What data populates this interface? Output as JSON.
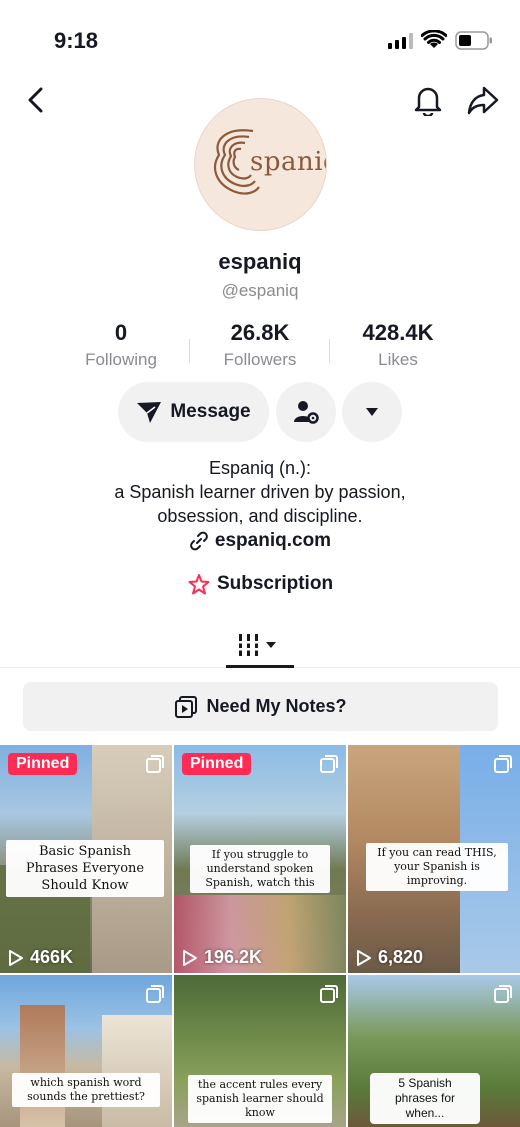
{
  "status_bar": {
    "time": "9:18"
  },
  "profile": {
    "avatar_text": "spaniq",
    "username": "espaniq",
    "handle": "@espaniq"
  },
  "stats": [
    {
      "value": "0",
      "label": "Following"
    },
    {
      "value": "26.8K",
      "label": "Followers"
    },
    {
      "value": "428.4K",
      "label": "Likes"
    }
  ],
  "actions": {
    "message_label": "Message"
  },
  "bio": {
    "line1": "Espaniq (n.):",
    "line2": "a Spanish learner driven by passion,",
    "line3": "obsession, and discipline.",
    "link": "espaniq.com",
    "subscription": "Subscription"
  },
  "notes_button": "Need My Notes?",
  "videos": [
    {
      "pinned": "Pinned",
      "caption": "Basic Spanish Phrases Everyone Should Know",
      "views": "466K"
    },
    {
      "pinned": "Pinned",
      "caption": "If you struggle to understand spoken Spanish, watch this",
      "views": "196.2K"
    },
    {
      "pinned": "",
      "caption": "If you can read THIS, your Spanish is improving.",
      "views": "6,820"
    },
    {
      "pinned": "",
      "caption": "which spanish word sounds the prettiest?",
      "views": ""
    },
    {
      "pinned": "",
      "caption": "the accent rules every spanish learner should know",
      "views": ""
    },
    {
      "pinned": "",
      "caption": "5 Spanish phrases for when...",
      "views": ""
    }
  ],
  "colors": {
    "pinned": "#fe2c55",
    "text": "#161823",
    "muted": "#8a8b91",
    "button_bg": "#f1f1f2"
  }
}
